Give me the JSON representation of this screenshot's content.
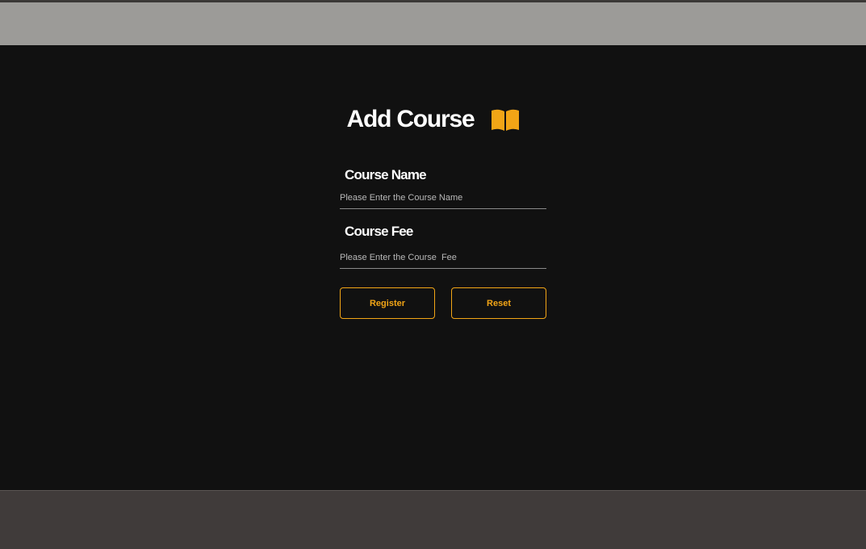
{
  "form": {
    "title": "Add Course",
    "title_icon": "book-open-icon",
    "fields": [
      {
        "label": "Course Name",
        "value": "",
        "placeholder": "Please Enter the Course Name"
      },
      {
        "label": "Course Fee",
        "value": "",
        "placeholder": "Please Enter the Course  Fee"
      }
    ],
    "buttons": {
      "register_label": "Register",
      "reset_label": "Reset"
    }
  },
  "colors": {
    "background": "#111111",
    "header": "#9c9b98",
    "footer": "#403b3a",
    "accent": "#f2a516",
    "text": "#ffffff"
  }
}
